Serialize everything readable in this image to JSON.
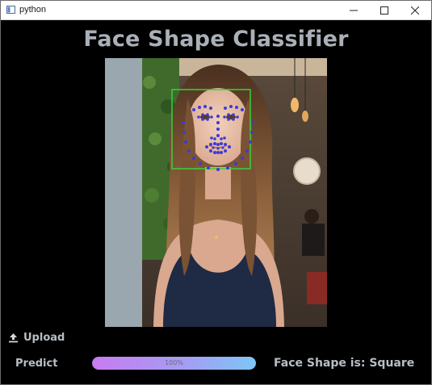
{
  "window": {
    "title": "python"
  },
  "app": {
    "heading": "Face Shape Classifier",
    "upload_label": "Upload",
    "predict_label": "Predict",
    "progress_percent": 100,
    "progress_text": "100%",
    "result_text": "Face Shape is: Square"
  },
  "icons": {
    "app": "python-window-icon",
    "minimize": "minimize-icon",
    "maximize": "maximize-icon",
    "close": "close-icon",
    "upload": "upload-icon"
  },
  "colors": {
    "background": "#000000",
    "heading": "#aab0b8",
    "text": "#b8bec6",
    "face_box": "#39d13a",
    "landmarks": "#3b3bd6",
    "progress_start": "#c77cf2",
    "progress_end": "#7fc6f5"
  }
}
